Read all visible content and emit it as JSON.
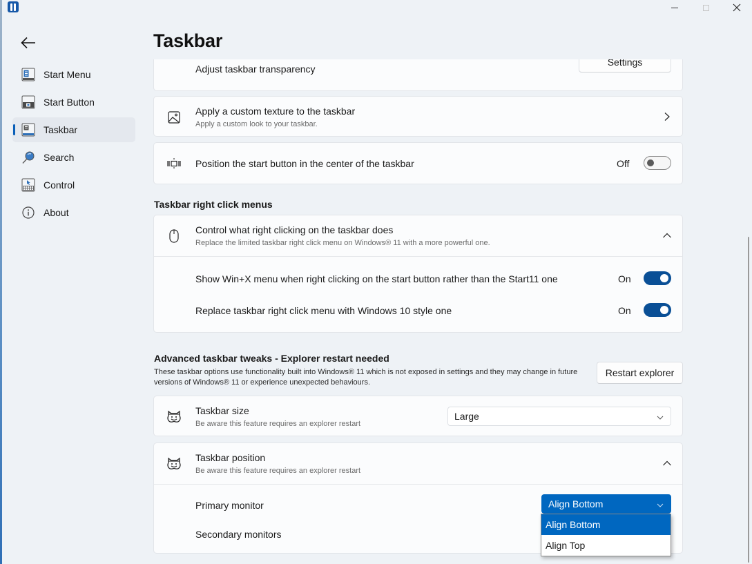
{
  "window": {
    "minimize_label": "Minimize",
    "maximize_label": "Maximize",
    "close_label": "Close"
  },
  "nav": {
    "back_label": "Back",
    "items": [
      {
        "label": "Start Menu",
        "icon": "start-menu-icon"
      },
      {
        "label": "Start Button",
        "icon": "start-button-icon"
      },
      {
        "label": "Taskbar",
        "icon": "taskbar-icon",
        "active": true
      },
      {
        "label": "Search",
        "icon": "search-icon"
      },
      {
        "label": "Control",
        "icon": "control-icon"
      },
      {
        "label": "About",
        "icon": "info-icon"
      }
    ]
  },
  "page": {
    "title": "Taskbar"
  },
  "settings": {
    "transparency": {
      "title": "Adjust taskbar transparency",
      "button": "Settings"
    },
    "texture": {
      "title": "Apply a custom texture to the taskbar",
      "subtitle": "Apply a custom look to your taskbar.",
      "icon": "image-icon"
    },
    "center_start": {
      "title": "Position the start button in the center of the taskbar",
      "state": "Off",
      "icon": "center-align-icon"
    },
    "right_click_section": {
      "heading": "Taskbar right click menus",
      "card": {
        "title": "Control what right clicking on the taskbar does",
        "subtitle": "Replace the limited taskbar right click menu on Windows® 11 with a more powerful one.",
        "icon": "mouse-icon",
        "expanded": true,
        "options": [
          {
            "label": "Show Win+X menu when right clicking on the start button rather than the Start11 one",
            "state": "On"
          },
          {
            "label": "Replace taskbar right click menu with Windows 10 style one",
            "state": "On"
          }
        ]
      }
    },
    "advanced_section": {
      "heading": "Advanced taskbar tweaks - Explorer restart needed",
      "description": "These taskbar options use functionality built into Windows® 11 which is not exposed in settings and they may change in future versions of Windows® 11 or experience unexpected behaviours.",
      "restart_button": "Restart explorer",
      "size": {
        "title": "Taskbar size",
        "subtitle": "Be aware this feature requires an explorer restart",
        "value": "Large",
        "icon": "cat-icon"
      },
      "position": {
        "title": "Taskbar position",
        "subtitle": "Be aware this feature requires an explorer restart",
        "icon": "cat-icon",
        "expanded": true,
        "primary_label": "Primary monitor",
        "primary_value": "Align Bottom",
        "secondary_label": "Secondary monitors",
        "dropdown_options": [
          "Align Bottom",
          "Align Top"
        ],
        "dropdown_selected": "Align Bottom"
      }
    }
  },
  "colors": {
    "accent": "#0067c0",
    "toggle_on": "#0a4f96"
  }
}
